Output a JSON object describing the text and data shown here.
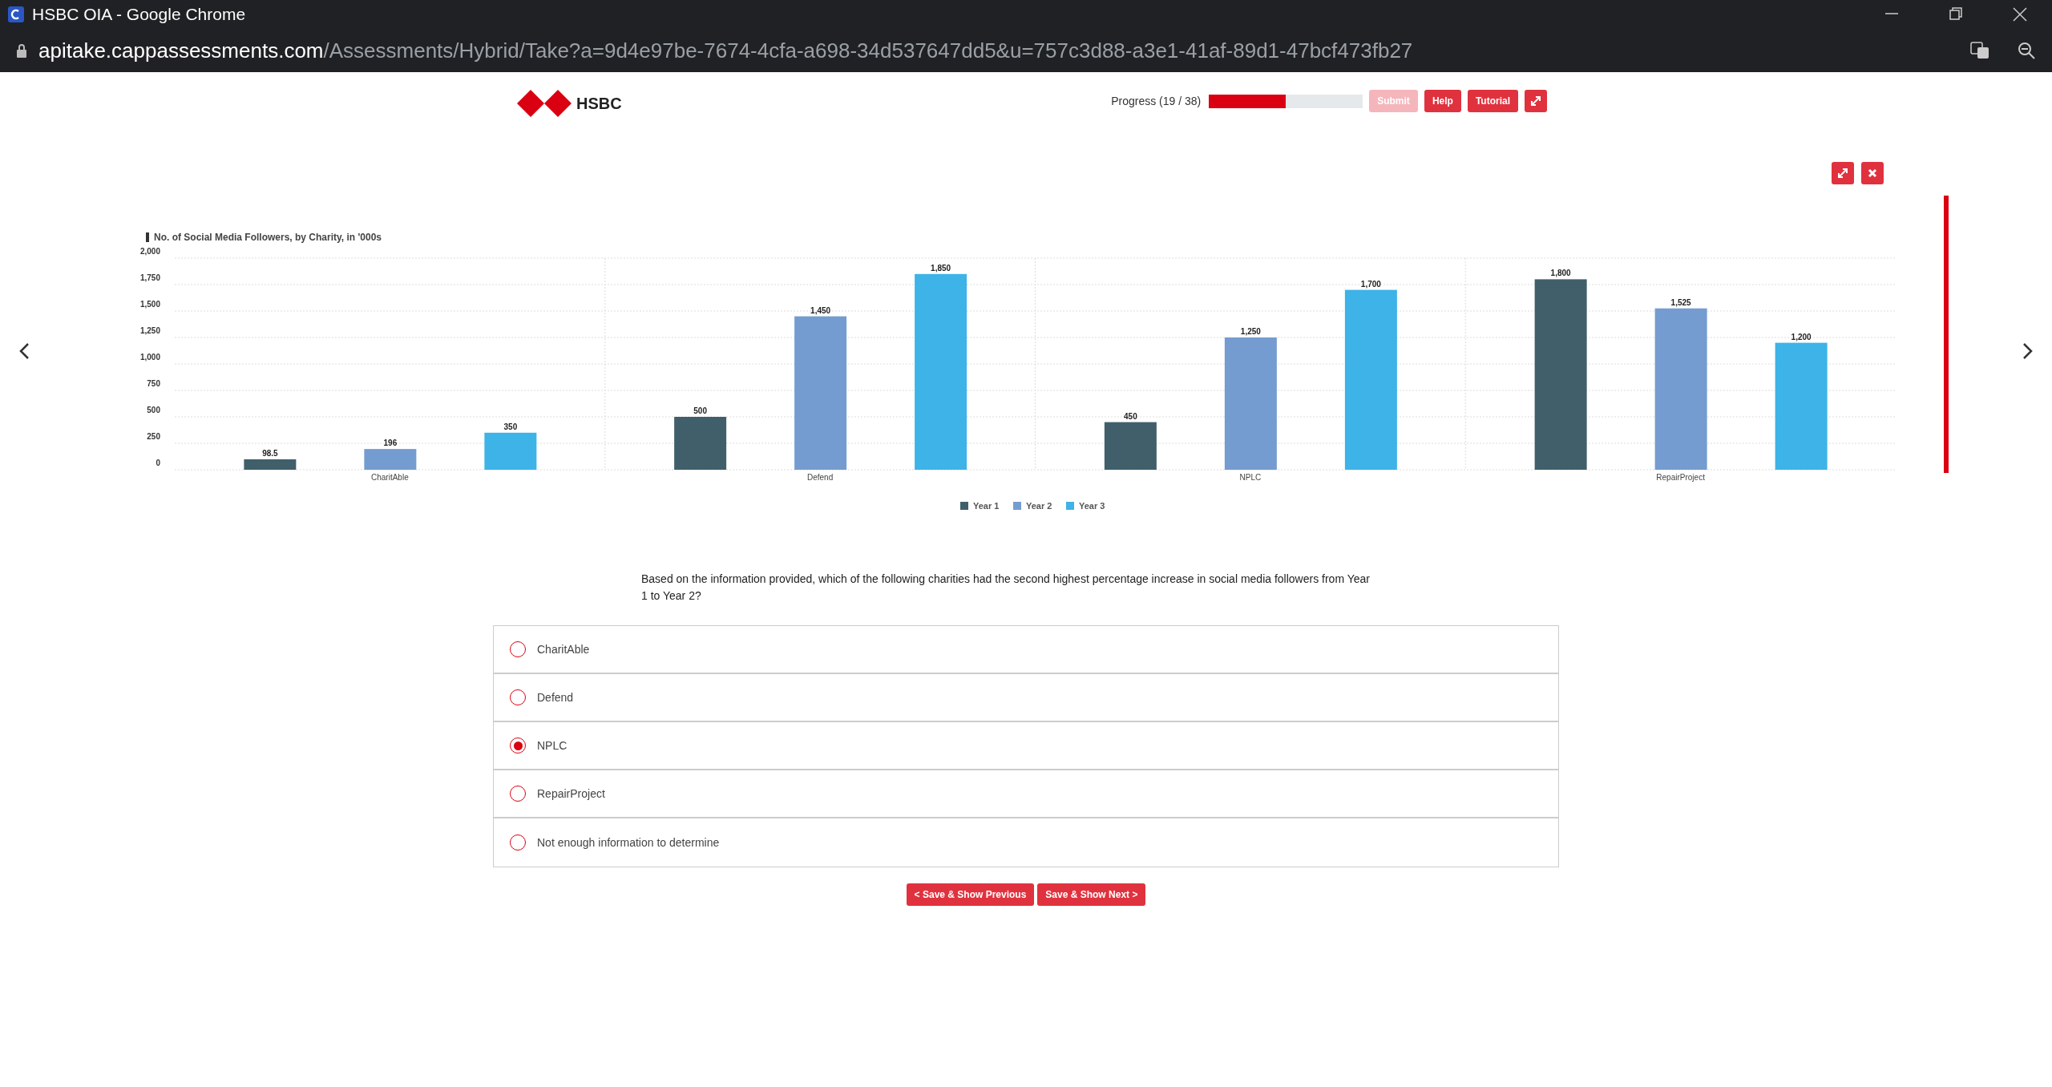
{
  "window": {
    "title": "HSBC OIA - Google Chrome"
  },
  "address_bar": {
    "host": "apitake.cappassessments.com",
    "path": "/Assessments/Hybrid/Take?a=9d4e97be-7674-4cfa-a698-34d537647dd5&u=757c3d88-a3e1-41af-89d1-47bcf473fb27"
  },
  "header": {
    "logo_text": "HSBC",
    "progress": {
      "label": "Progress (19 / 38)",
      "level": 0.5
    },
    "buttons": [
      {
        "label": "Submit",
        "disabled": true
      },
      {
        "label": "Help",
        "disabled": false
      },
      {
        "label": "Tutorial",
        "disabled": false
      }
    ]
  },
  "chart_data": {
    "type": "bar",
    "title": "No. of Social Media Followers, by Charity, in '000s",
    "categories": [
      "CharitAble",
      "Defend",
      "NPLC",
      "RepairProject"
    ],
    "series": [
      {
        "name": "Year 1",
        "color": "#405f6b",
        "values": [
          98.5,
          500,
          450,
          1800
        ]
      },
      {
        "name": "Year 2",
        "color": "#749cd0",
        "values": [
          196,
          1450,
          1250,
          1525
        ]
      },
      {
        "name": "Year 3",
        "color": "#3db3e8",
        "values": [
          350,
          1850,
          1700,
          1200
        ]
      }
    ],
    "value_labels": [
      [
        "98.5",
        "500",
        "450",
        "1,800"
      ],
      [
        "196",
        "1,450",
        "1,250",
        "1,525"
      ],
      [
        "350",
        "1,850",
        "1,700",
        "1,200"
      ]
    ],
    "ylim": [
      0,
      2000
    ],
    "yticks": [
      {
        "value": 0,
        "label": "0"
      },
      {
        "value": 250,
        "label": "250"
      },
      {
        "value": 500,
        "label": "500"
      },
      {
        "value": 750,
        "label": "750"
      },
      {
        "value": 1000,
        "label": "1,000"
      },
      {
        "value": 1250,
        "label": "1,250"
      },
      {
        "value": 1500,
        "label": "1,500"
      },
      {
        "value": 1750,
        "label": "1,750"
      },
      {
        "value": 2000,
        "label": "2,000"
      }
    ],
    "grid": true,
    "legend": true
  },
  "question": "Based on the information provided, which of the following charities had the second highest percentage increase in social media followers from Year 1 to Year 2?",
  "options": [
    {
      "label": "CharitAble",
      "selected": false
    },
    {
      "label": "Defend",
      "selected": false
    },
    {
      "label": "NPLC",
      "selected": true
    },
    {
      "label": "RepairProject",
      "selected": false
    },
    {
      "label": "Not enough information to determine",
      "selected": false
    }
  ],
  "nav_buttons": [
    "< Save & Show Previous",
    "Save & Show Next >"
  ]
}
